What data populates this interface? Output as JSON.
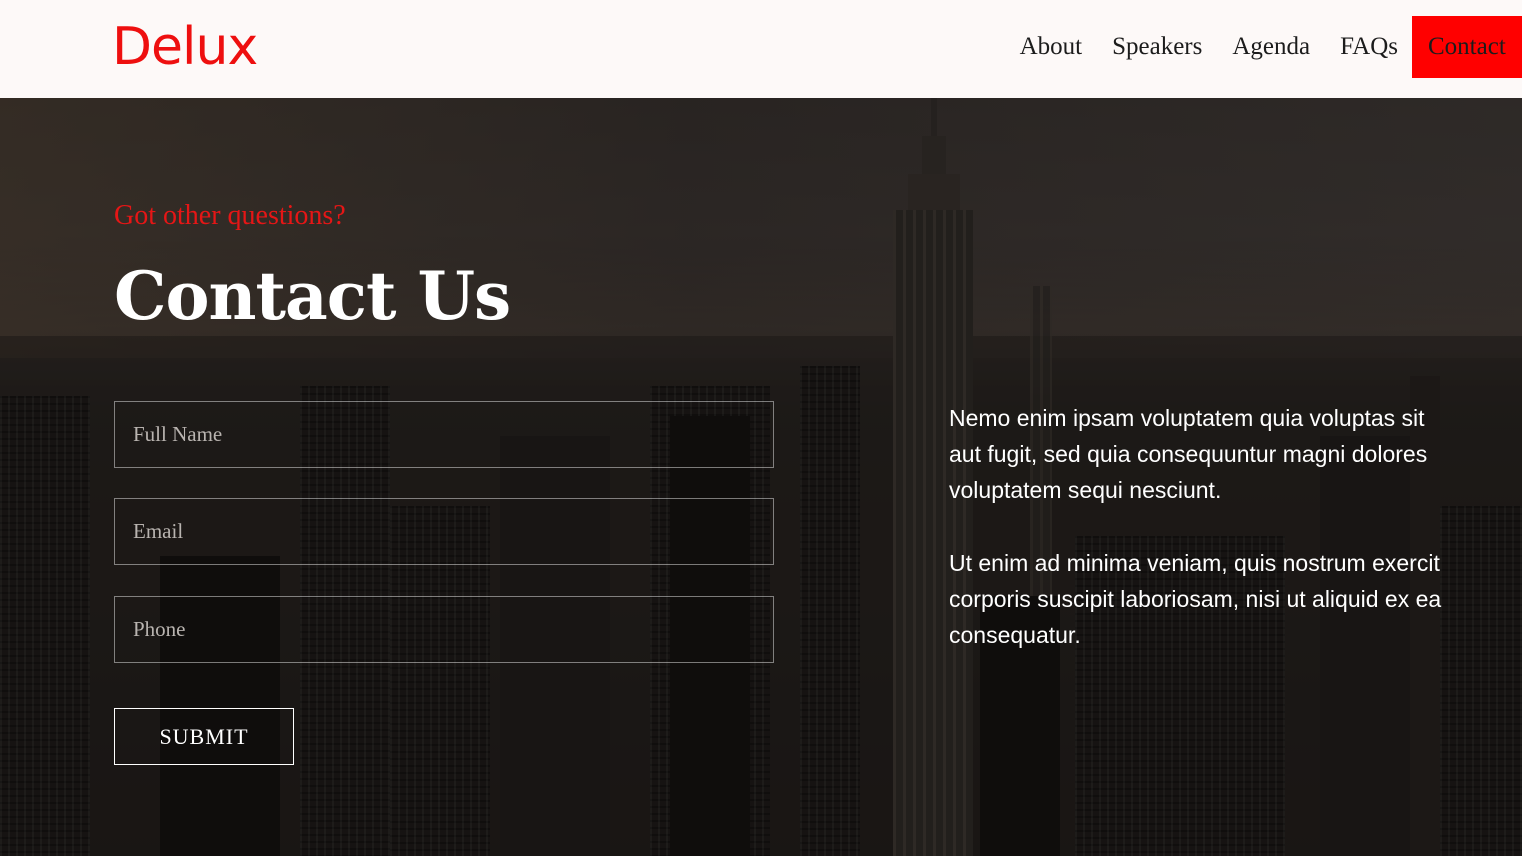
{
  "header": {
    "logo": "Delux",
    "nav": [
      {
        "label": "About"
      },
      {
        "label": "Speakers"
      },
      {
        "label": "Agenda"
      },
      {
        "label": "FAQs"
      },
      {
        "label": "Contact",
        "active": true
      }
    ]
  },
  "contact": {
    "eyebrow": "Got other questions?",
    "title": "Contact Us",
    "form": {
      "full_name_placeholder": "Full Name",
      "email_placeholder": "Email",
      "phone_placeholder": "Phone",
      "submit_label": "SUBMIT"
    },
    "paragraph1": {
      "line1": "Nemo enim ipsam voluptatem quia voluptas sit",
      "line2": "aut fugit, sed quia consequuntur magni dolores",
      "line3": "voluptatem sequi nesciunt."
    },
    "paragraph2": {
      "line1": "Ut enim ad minima veniam, quis nostrum exercit",
      "line2": "corporis suscipit laboriosam, nisi ut aliquid ex ea",
      "line3": "consequatur."
    }
  },
  "colors": {
    "accent": "#ff0000",
    "header_bg": "#fdf9f8",
    "text_light": "#ffffff"
  }
}
